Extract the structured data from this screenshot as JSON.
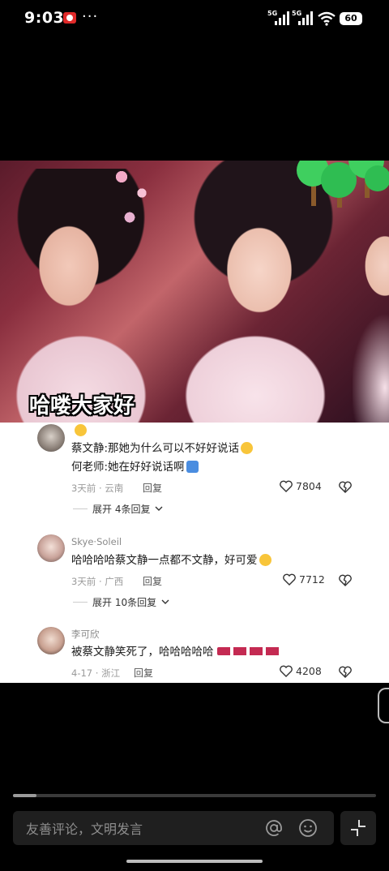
{
  "status_bar": {
    "time": "9:03",
    "dots": "···",
    "network1": "5G",
    "network2": "5G",
    "battery": "60"
  },
  "video": {
    "caption": "哈喽大家好"
  },
  "comments": [
    {
      "username": "",
      "lines": [
        "蔡文静:那她为什么可以不好好说话",
        "何老师:她在好好说话啊"
      ],
      "time": "3天前",
      "location": "云南",
      "reply_label": "回复",
      "likes": "7804",
      "expand_label": "展开 4条回复"
    },
    {
      "username": "Skye·Soleil",
      "lines": [
        "哈哈哈哈蔡文静一点都不文静，好可爱"
      ],
      "time": "3天前",
      "location": "广西",
      "reply_label": "回复",
      "likes": "7712",
      "expand_label": "展开 10条回复"
    },
    {
      "username": "李可欣",
      "lines": [
        "被蔡文静笑死了，哈哈哈哈哈"
      ],
      "time": "4-17",
      "location": "浙江",
      "reply_label": "回复",
      "likes": "4208"
    }
  ],
  "playback": {
    "progress": 0.065
  },
  "comment_input": {
    "placeholder": "友善评论，文明发言"
  },
  "icons": {
    "at": "at-icon",
    "emoji": "smile-icon",
    "expand": "expand-icon",
    "like": "heart-icon",
    "dislike": "broken-heart-icon",
    "record": "screen-record-icon"
  },
  "colors": {
    "background": "#000000",
    "comment_panel": "#ffffff",
    "input": "#1f1f1f",
    "record": "#e02a2a"
  }
}
